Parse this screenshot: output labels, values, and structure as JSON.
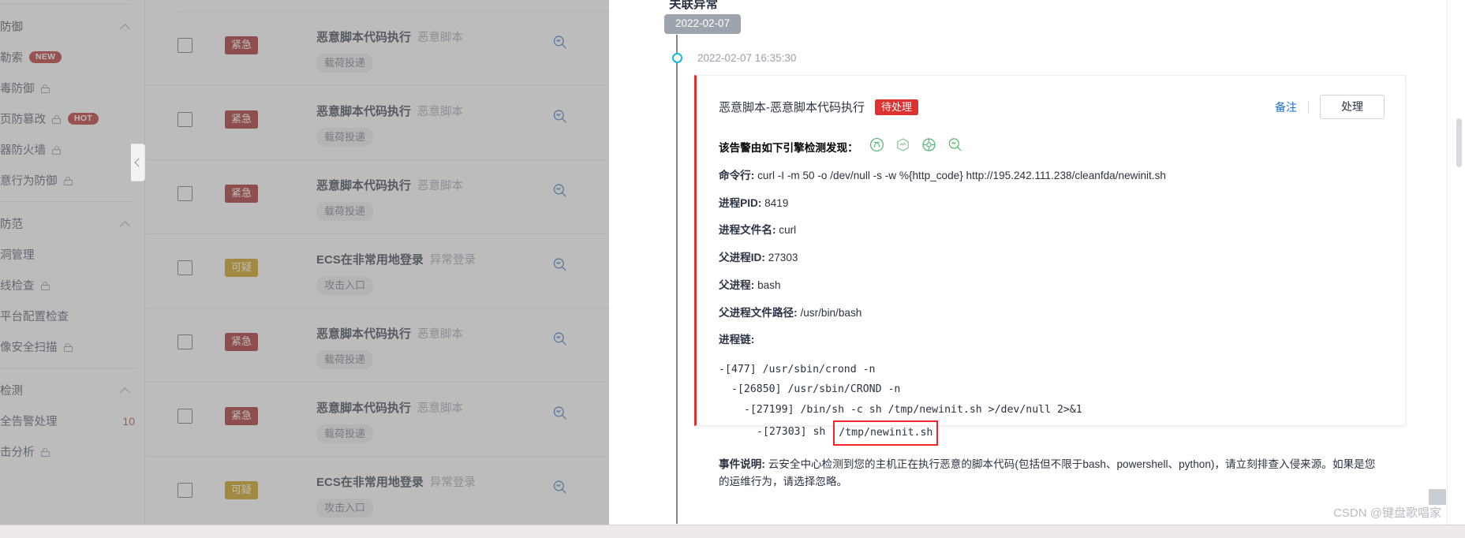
{
  "sidebar": {
    "groups": [
      {
        "header": "防御",
        "header_full": "主动防御",
        "items": [
          {
            "label": "勒索",
            "label_full": "防勒索",
            "tag": "NEW",
            "tag_color": "#b3231f",
            "lock": false
          },
          {
            "label": "毒防御",
            "label_full": "病毒防御",
            "lock": true
          },
          {
            "label": "页防篡改",
            "label_full": "网页防篡改",
            "tag": "HOT",
            "tag_color": "#b3231f",
            "lock": true
          },
          {
            "label": "器防火墙",
            "label_full": "容器防火墙",
            "lock": true
          },
          {
            "label": "意行为防御",
            "label_full": "恶意行为防御",
            "lock": true
          }
        ]
      },
      {
        "header": "防范",
        "header_full": "风险防范",
        "items": [
          {
            "label": "洞管理",
            "label_full": "漏洞管理",
            "lock": false
          },
          {
            "label": "线检查",
            "label_full": "基线检查",
            "lock": true
          },
          {
            "label": "平台配置检查",
            "label_full": "云平台配置检查",
            "lock": false
          },
          {
            "label": "像安全扫描",
            "label_full": "镜像安全扫描",
            "lock": true
          }
        ]
      },
      {
        "header": "检测",
        "header_full": "入侵检测",
        "items": [
          {
            "label": "全告警处理",
            "label_full": "安全告警处理",
            "lock": false,
            "count": "10"
          },
          {
            "label": "击分析",
            "label_full": "攻击分析",
            "lock": true
          }
        ]
      }
    ]
  },
  "alert_list": {
    "rows": [
      {
        "severity": "紧急",
        "severity_color": "#a01b1b",
        "title": "恶意脚本代码执行",
        "subtype": "恶意脚本",
        "chip": "载荷投递",
        "checked": false
      },
      {
        "severity": "紧急",
        "severity_color": "#a01b1b",
        "title": "恶意脚本代码执行",
        "subtype": "恶意脚本",
        "chip": "载荷投递",
        "checked": false
      },
      {
        "severity": "紧急",
        "severity_color": "#a01b1b",
        "title": "恶意脚本代码执行",
        "subtype": "恶意脚本",
        "chip": "载荷投递",
        "checked": false
      },
      {
        "severity": "可疑",
        "severity_color": "#c99400",
        "title": "ECS在非常用地登录",
        "subtype": "异常登录",
        "chip": "攻击入口",
        "checked": false
      },
      {
        "severity": "紧急",
        "severity_color": "#a01b1b",
        "title": "恶意脚本代码执行",
        "subtype": "恶意脚本",
        "chip": "载荷投递",
        "checked": false
      },
      {
        "severity": "紧急",
        "severity_color": "#a01b1b",
        "title": "恶意脚本代码执行",
        "subtype": "恶意脚本",
        "chip": "载荷投递",
        "checked": false
      },
      {
        "severity": "可疑",
        "severity_color": "#c99400",
        "title": "ECS在非常用地登录",
        "subtype": "异常登录",
        "chip": "攻击入口",
        "checked": false
      }
    ]
  },
  "detail": {
    "section_title": "关联异常",
    "date_pill": "2022-02-07",
    "event_time": "2022-02-07 16:35:30",
    "card": {
      "title": "恶意脚本-恶意脚本代码执行",
      "status": "待处理",
      "status_color": "#e03131",
      "remark_label": "备注",
      "handle_label": "处理",
      "engines_label": "该告警由如下引擎检测发现：",
      "engine_icons": [
        "engine-knot-icon",
        "engine-wave-hex-icon",
        "engine-target-icon",
        "engine-search-wave-icon"
      ],
      "engine_color": "#52b56a",
      "fields": [
        {
          "label": "命令行:",
          "value": "curl -I -m 50 -o /dev/null -s -w %{http_code} http://195.242.111.238/cleanfda/newinit.sh"
        },
        {
          "label": "进程PID:",
          "value": "8419"
        },
        {
          "label": "进程文件名:",
          "value": "curl"
        },
        {
          "label": "父进程ID:",
          "value": "27303"
        },
        {
          "label": "父进程:",
          "value": "bash"
        },
        {
          "label": "父进程文件路径:",
          "value": "/usr/bin/bash"
        }
      ],
      "chain_label": "进程链:",
      "chain_lines": [
        {
          "indent": 0,
          "text": "-[477] /usr/sbin/crond -n",
          "highlight": ""
        },
        {
          "indent": 1,
          "text": "-[26850] /usr/sbin/CROND -n",
          "highlight": ""
        },
        {
          "indent": 2,
          "text": "-[27199] /bin/sh -c sh /tmp/newinit.sh >/dev/null 2>&1",
          "highlight": ""
        },
        {
          "indent": 3,
          "text": "-[27303] sh ",
          "highlight": "/tmp/newinit.sh"
        }
      ],
      "desc_label": "事件说明:",
      "desc_value": "云安全中心检测到您的主机正在执行恶意的脚本代码(包括但不限于bash、powershell、python)，请立刻排查入侵来源。如果是您的运维行为，请选择忽略。"
    }
  },
  "watermark": "CSDN @键盘歌唱家"
}
